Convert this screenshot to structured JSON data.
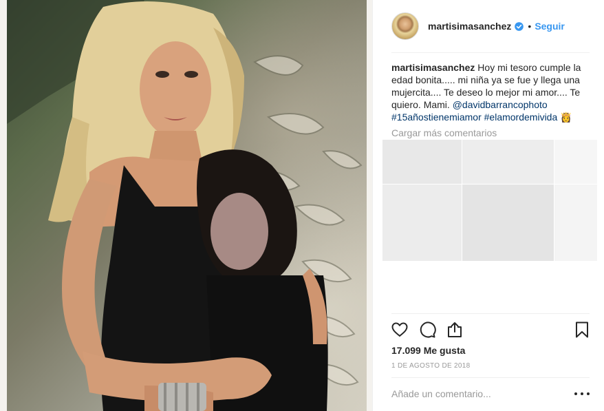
{
  "post": {
    "username": "martisimasanchez",
    "follow_label": "Seguir",
    "dot": "•",
    "caption": {
      "user": "martisimasanchez",
      "text": "Hoy mi tesoro cumple la edad bonita..... mi niña ya se fue y llega una mujercita.... Te deseo lo mejor mi amor.... Te quiero. Mami.",
      "mention": "@davidbarrancophoto",
      "hashtag1": "#15añostienemiamor",
      "hashtag2": "#elamordemivida",
      "emoji": "👸"
    },
    "load_more": "Cargar más comentarios",
    "likes": "17.099 Me gusta",
    "date": "1 DE AGOSTO DE 2018",
    "comment_placeholder": "Añade un comentario..."
  },
  "colors": {
    "link": "#3897f0",
    "hashtag": "#003569",
    "muted": "#999999"
  },
  "icons": {
    "verified": "verified-badge-icon",
    "like": "heart-icon",
    "comment": "comment-bubble-icon",
    "share": "share-icon",
    "save": "bookmark-icon",
    "more": "more-options-icon"
  }
}
